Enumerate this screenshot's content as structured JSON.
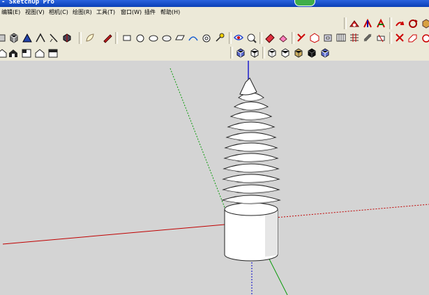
{
  "window": {
    "title": "- SketchUp Pro"
  },
  "menus": [
    "编辑(E)",
    "视图(V)",
    "相机(C)",
    "绘图(R)",
    "工具(T)",
    "窗口(W)",
    "插件",
    "帮助(H)"
  ],
  "colors": {
    "sky": "#d4d4d4",
    "red_axis": "#c00000",
    "green_axis": "#0a9a0a",
    "blue_axis": "#0000cc",
    "screw_face": "#ffffff",
    "screw_shade": "#b8b8b8"
  },
  "toolbars": {
    "row1_right": [
      "camera-icon",
      "axes-icon",
      "axes-icon",
      "section-plane-icon",
      "undo-icon",
      "rotate-icon",
      "cube-icon"
    ],
    "row2_left": [
      "pushpull-icon",
      "shapes-icon",
      "follow-icon",
      "lines-icon",
      "component-icon"
    ],
    "row2_mid": [
      "warehouse-icon",
      "pencil-icon",
      "rectangle-icon",
      "circle-icon",
      "circle-icon",
      "circle-icon",
      "circle-icon",
      "polygon-icon",
      "arc-icon",
      "circle-icon",
      "tape-icon",
      "paint-icon",
      "zoom-icon",
      "eraser-icon",
      "text-icon"
    ],
    "row2_right": [
      "move-icon",
      "rotate-icon",
      "scale-icon",
      "offset-icon",
      "followme-icon",
      "protractor-icon",
      "dimension-icon",
      "pencil-icon",
      "eraser-icon"
    ],
    "row3_left": [
      "home-icon",
      "front-view-icon",
      "back-view-icon",
      "side-view-icon"
    ],
    "row3_views": [
      "iso-view-icon",
      "wireframe-icon",
      "hidden-line-icon",
      "shaded-icon",
      "textured-icon",
      "monochrome-icon",
      "xray-icon"
    ]
  }
}
